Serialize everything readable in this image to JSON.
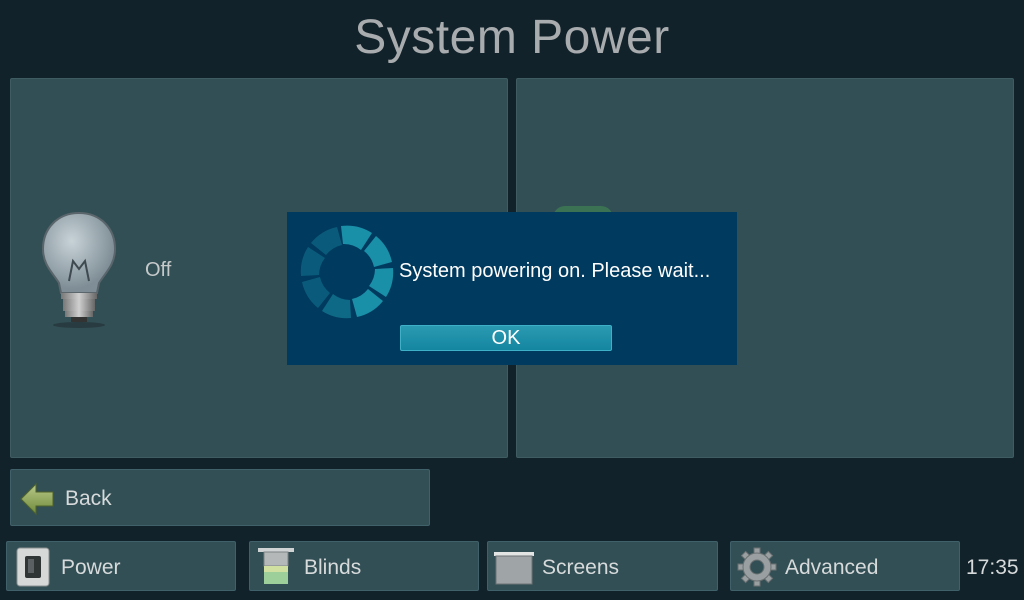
{
  "header": {
    "title": "System Power"
  },
  "left_panel": {
    "status_label": "Off",
    "icon": "lightbulb-icon"
  },
  "back": {
    "label": "Back",
    "icon": "arrow-left-icon"
  },
  "nav": {
    "items": [
      {
        "label": "Power",
        "icon": "power-switch-icon"
      },
      {
        "label": "Blinds",
        "icon": "blinds-icon"
      },
      {
        "label": "Screens",
        "icon": "projection-screen-icon"
      },
      {
        "label": "Advanced",
        "icon": "gear-icon"
      }
    ]
  },
  "clock": {
    "time": "17:35"
  },
  "dialog": {
    "message": "System powering on. Please wait...",
    "ok_label": "OK",
    "icon": "spinner-icon"
  },
  "colors": {
    "background": "#12222a",
    "panel": "#324f55",
    "dialog": "#003a5e",
    "ok_button": "#1e90aa",
    "spinner": "#1a8fa8"
  }
}
